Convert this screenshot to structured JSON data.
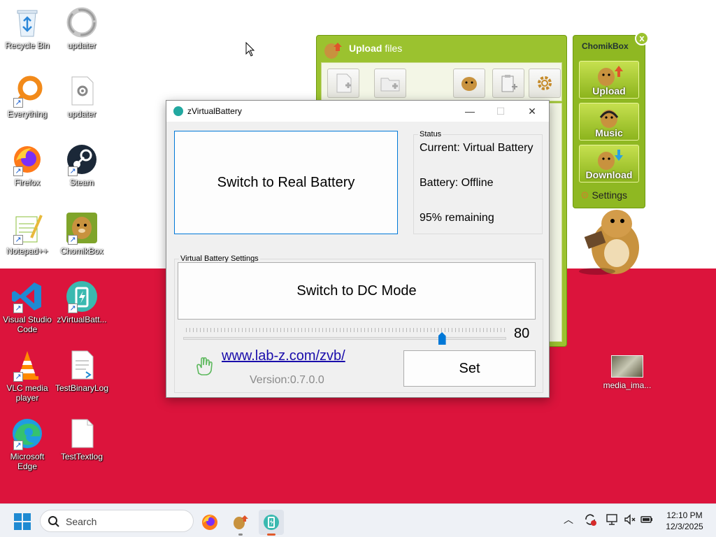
{
  "desktop": {
    "icons": [
      {
        "label": "Recycle Bin"
      },
      {
        "label": "updater"
      },
      {
        "label": "Everything"
      },
      {
        "label": "updater"
      },
      {
        "label": "Firefox"
      },
      {
        "label": "Steam"
      },
      {
        "label": "Notepad++"
      },
      {
        "label": "ChomikBox"
      },
      {
        "label": "Visual Studio Code"
      },
      {
        "label": "zVirtualBatt..."
      },
      {
        "label": "VLC media player"
      },
      {
        "label": "TestBinaryLog"
      },
      {
        "label": "Microsoft Edge"
      },
      {
        "label": "TestTextlog"
      }
    ],
    "media_label": "media_ima..."
  },
  "upload_window": {
    "title_bold": "Upload",
    "title_rest": " files",
    "accent": "#9bc22f"
  },
  "chomik_panel": {
    "title": "ChomikBox",
    "close": "x",
    "buttons": [
      {
        "label": "Upload"
      },
      {
        "label": "Music"
      },
      {
        "label": "Download"
      }
    ],
    "settings_label": "Settings"
  },
  "zvb_window": {
    "title": "zVirtualBattery",
    "minimize": "—",
    "maximize": "☐",
    "close": "✕",
    "switch_real_label": "Switch to Real Battery",
    "status_group": "Status",
    "status_current": "Current: Virtual Battery",
    "status_battery": "Battery: Offline",
    "status_remaining": "95% remaining",
    "settings_group": "Virtual Battery Settings",
    "switch_dc_label": "Switch to DC Mode",
    "slider_value": "80",
    "slider_level": 80,
    "link": "www.lab-z.com/zvb/",
    "version": "Version:0.7.0.0",
    "set_label": "Set",
    "accent": "#0078d7"
  },
  "taskbar": {
    "search_placeholder": "Search",
    "time": "12:10 PM",
    "date": "12/3/2025",
    "icons": [
      "windows-start-icon",
      "firefox-icon",
      "chomikbox-icon",
      "zvirtualbattery-icon"
    ]
  }
}
